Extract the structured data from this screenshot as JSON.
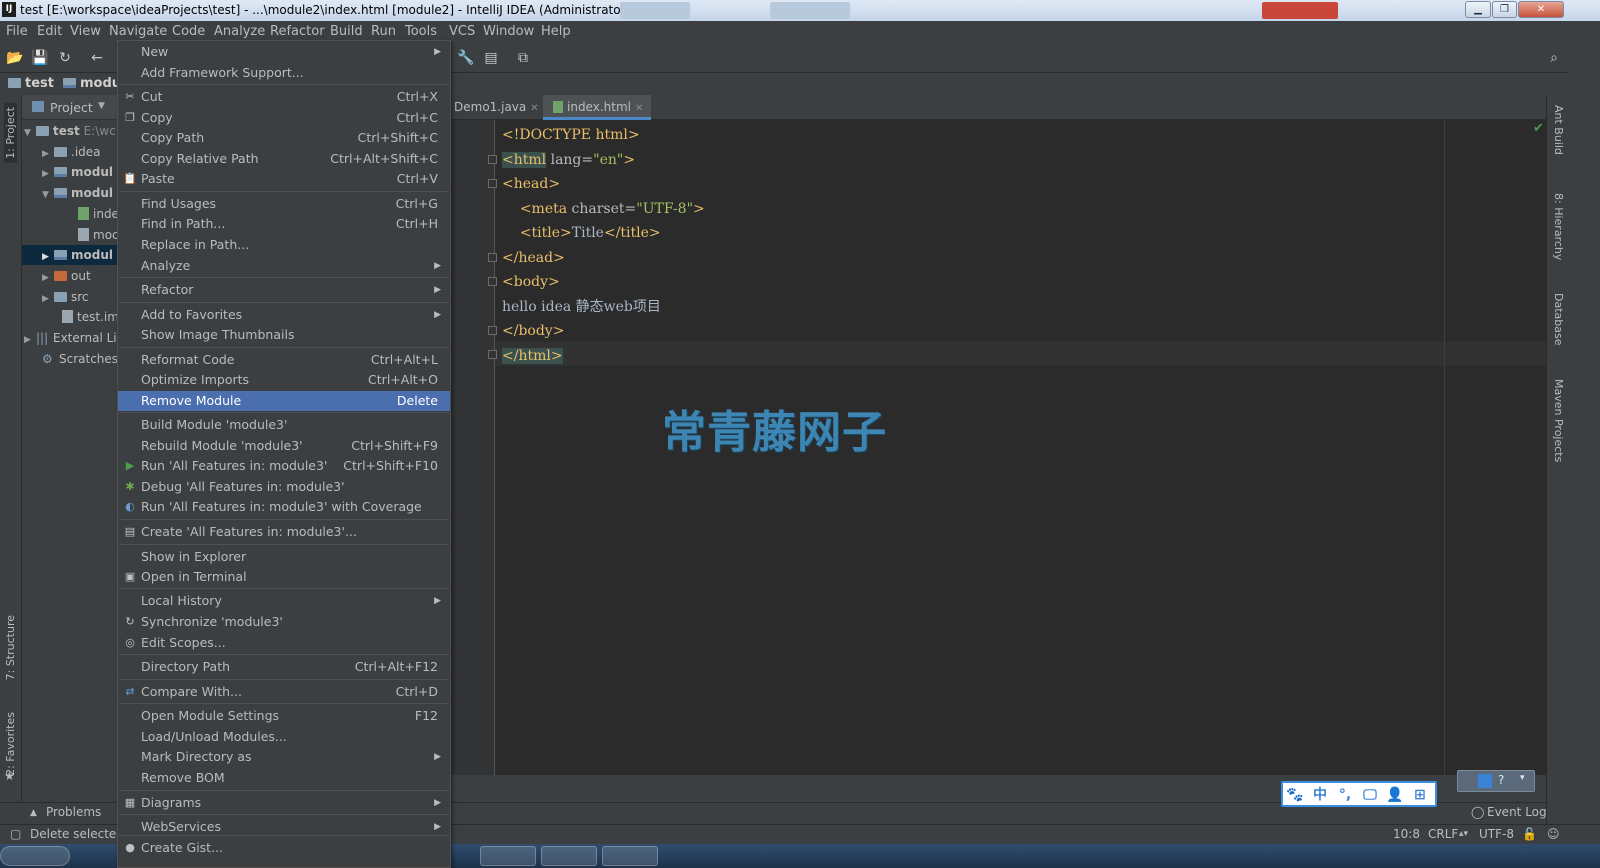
{
  "window": {
    "title": "test [E:\\workspace\\ideaProjects\\test] - ...\\module2\\index.html [module2] - IntelliJ IDEA (Administrator)",
    "app_icon_text": "IJ"
  },
  "menubar": [
    "File",
    "Edit",
    "View",
    "Navigate",
    "Code",
    "Analyze",
    "Refactor",
    "Build",
    "Run",
    "Tools",
    "VCS",
    "Window",
    "Help"
  ],
  "navbar": {
    "crumbs": [
      "test",
      "modu"
    ]
  },
  "left_strip": {
    "tabs": [
      "1: Project",
      "7: Structure",
      "2: Favorites"
    ]
  },
  "project_panel": {
    "header": "Project",
    "rows": [
      {
        "label": "test",
        "suffix": "E:\\wc"
      },
      {
        "label": ".idea"
      },
      {
        "label": "modul"
      },
      {
        "label": "modul"
      },
      {
        "label": "inde"
      },
      {
        "label": "moc"
      },
      {
        "label": "modul"
      },
      {
        "label": "out"
      },
      {
        "label": "src"
      },
      {
        "label": "test.iml"
      },
      {
        "label": "External Li"
      },
      {
        "label": "Scratches"
      }
    ]
  },
  "context_menu": {
    "items": [
      {
        "label": "New",
        "shortcut": "",
        "submenu": true
      },
      {
        "label": "Add Framework Support...",
        "shortcut": ""
      },
      {
        "label": "Cut",
        "shortcut": "Ctrl+X",
        "icon": "✂"
      },
      {
        "label": "Copy",
        "shortcut": "Ctrl+C",
        "icon": "❐"
      },
      {
        "label": "Copy Path",
        "shortcut": "Ctrl+Shift+C"
      },
      {
        "label": "Copy Relative Path",
        "shortcut": "Ctrl+Alt+Shift+C"
      },
      {
        "label": "Paste",
        "shortcut": "Ctrl+V",
        "icon": "📋"
      },
      {
        "label": "Find Usages",
        "shortcut": "Ctrl+G"
      },
      {
        "label": "Find in Path...",
        "shortcut": "Ctrl+H"
      },
      {
        "label": "Replace in Path...",
        "shortcut": ""
      },
      {
        "label": "Analyze",
        "shortcut": "",
        "submenu": true
      },
      {
        "label": "Refactor",
        "shortcut": "",
        "submenu": true
      },
      {
        "label": "Add to Favorites",
        "shortcut": "",
        "submenu": true
      },
      {
        "label": "Show Image Thumbnails",
        "shortcut": ""
      },
      {
        "label": "Reformat Code",
        "shortcut": "Ctrl+Alt+L"
      },
      {
        "label": "Optimize Imports",
        "shortcut": "Ctrl+Alt+O"
      },
      {
        "label": "Remove Module",
        "shortcut": "Delete"
      },
      {
        "label": "Build Module 'module3'",
        "shortcut": ""
      },
      {
        "label": "Rebuild Module 'module3'",
        "shortcut": "Ctrl+Shift+F9"
      },
      {
        "label": "Run 'All Features in: module3'",
        "shortcut": "Ctrl+Shift+F10",
        "icon": "▶"
      },
      {
        "label": "Debug 'All Features in: module3'",
        "shortcut": "",
        "icon": "✱"
      },
      {
        "label": "Run 'All Features in: module3' with Coverage",
        "shortcut": "",
        "icon": "◐"
      },
      {
        "label": "Create 'All Features in: module3'...",
        "shortcut": "",
        "icon": "▤"
      },
      {
        "label": "Show in Explorer",
        "shortcut": ""
      },
      {
        "label": "Open in Terminal",
        "shortcut": "",
        "icon": "▣"
      },
      {
        "label": "Local History",
        "shortcut": "",
        "submenu": true
      },
      {
        "label": "Synchronize 'module3'",
        "shortcut": "",
        "icon": "↻"
      },
      {
        "label": "Edit Scopes...",
        "shortcut": "",
        "icon": "◎"
      },
      {
        "label": "Directory Path",
        "shortcut": "Ctrl+Alt+F12"
      },
      {
        "label": "Compare With...",
        "shortcut": "Ctrl+D",
        "icon": "⇄"
      },
      {
        "label": "Open Module Settings",
        "shortcut": "F12"
      },
      {
        "label": "Load/Unload Modules...",
        "shortcut": ""
      },
      {
        "label": "Mark Directory as",
        "shortcut": "",
        "submenu": true
      },
      {
        "label": "Remove BOM",
        "shortcut": ""
      },
      {
        "label": "Diagrams",
        "shortcut": "",
        "submenu": true,
        "icon": "▦"
      },
      {
        "label": "WebServices",
        "shortcut": "",
        "submenu": true
      },
      {
        "label": "Create Gist...",
        "shortcut": "",
        "icon": "●"
      }
    ]
  },
  "editor": {
    "tabs": [
      {
        "label": "Demo1.java",
        "active": false
      },
      {
        "label": "index.html",
        "active": true
      }
    ],
    "lines": [
      {
        "parts": [
          [
            "tag",
            "<!DOCTYPE html>"
          ]
        ]
      },
      {
        "parts": [
          [
            "tag-hl",
            "<html"
          ],
          [
            "attr",
            " lang="
          ],
          [
            "str",
            "\"en\""
          ],
          [
            "tag",
            ">"
          ]
        ]
      },
      {
        "parts": [
          [
            "tag",
            "<head>"
          ]
        ]
      },
      {
        "parts": [
          [
            "plain",
            "    "
          ],
          [
            "tag",
            "<meta"
          ],
          [
            "attr",
            " charset="
          ],
          [
            "str",
            "\"UTF-8\""
          ],
          [
            "tag",
            ">"
          ]
        ]
      },
      {
        "parts": [
          [
            "plain",
            "    "
          ],
          [
            "tag",
            "<title>"
          ],
          [
            "plain",
            "Title"
          ],
          [
            "tag",
            "</title>"
          ]
        ]
      },
      {
        "parts": [
          [
            "tag",
            "</head>"
          ]
        ]
      },
      {
        "parts": [
          [
            "tag",
            "<body>"
          ]
        ]
      },
      {
        "parts": [
          [
            "plain",
            "hello idea 静态web项目"
          ]
        ]
      },
      {
        "parts": [
          [
            "tag",
            "</body>"
          ]
        ]
      },
      {
        "parts": [
          [
            "tag-hl",
            "</html>"
          ]
        ]
      }
    ]
  },
  "watermark": "常青藤网子",
  "right_strip": {
    "tabs": [
      "Ant Build",
      "8: Hierarchy",
      "Database",
      "Maven Projects"
    ]
  },
  "bottom": {
    "problems": "Problems",
    "event_log": "Event Log",
    "status_message": "Delete selected",
    "position": "10:8",
    "line_sep": "CRLF",
    "encoding": "UTF-8"
  },
  "ime": {
    "icons": [
      "🐾",
      "中",
      "°,",
      "🖵",
      "👤",
      "⊞"
    ]
  }
}
